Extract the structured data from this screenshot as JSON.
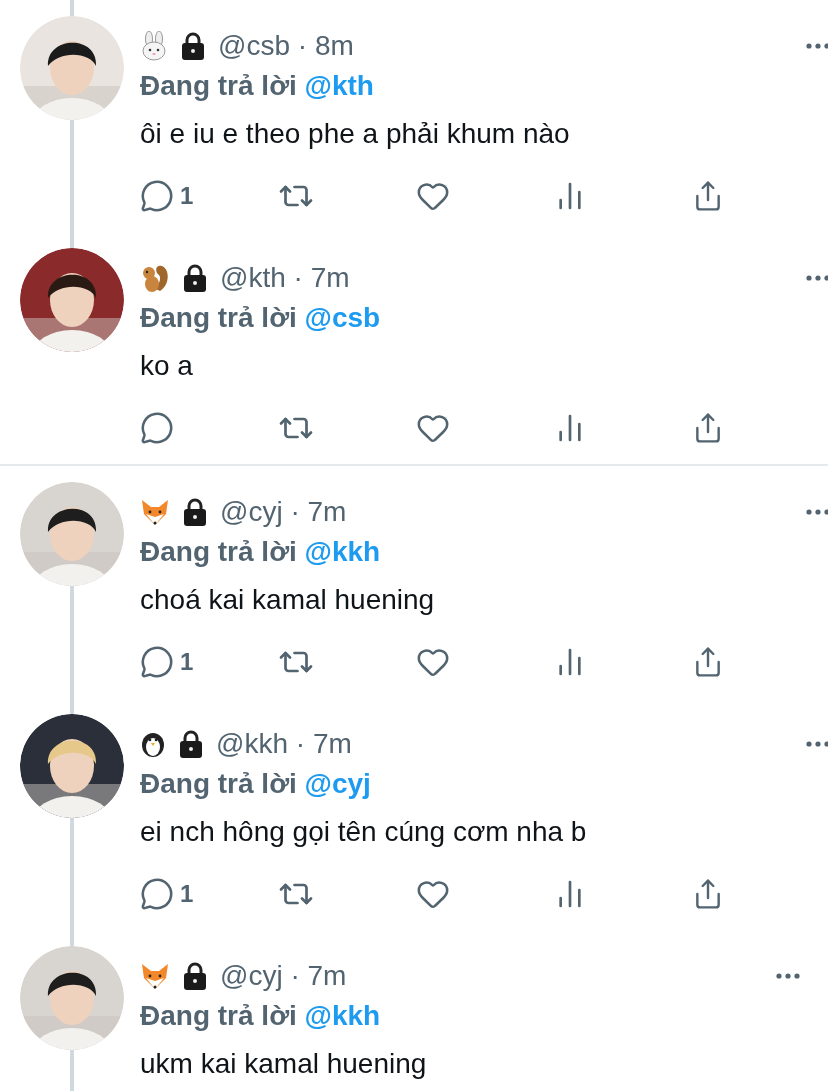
{
  "threads": [
    {
      "continues_above": true,
      "continues_below": false,
      "tweets": [
        {
          "badge": {
            "kind": "rabbit"
          },
          "meta": "@csb · 8m",
          "reply_label": "Đang trả lời",
          "reply_to": "@kth",
          "text": "ôi e iu e theo phe a phải khum nào",
          "actions": {
            "kind": "row",
            "reply_count": "1"
          }
        },
        {
          "badge": {
            "kind": "squirrel"
          },
          "meta": "@kth · 7m",
          "reply_label": "Đang trả lời",
          "reply_to": "@csb",
          "text": "ko a",
          "actions": {
            "kind": "row"
          }
        }
      ]
    },
    {
      "continues_above": false,
      "continues_below": true,
      "tweets": [
        {
          "badge": {
            "kind": "fox"
          },
          "meta": "@cyj · 7m",
          "reply_label": "Đang trả lời",
          "reply_to": "@kkh",
          "text": "choá kai kamal huening",
          "actions": {
            "kind": "row",
            "reply_count": "1"
          }
        },
        {
          "badge": {
            "kind": "penguin"
          },
          "meta": "@kkh · 7m",
          "reply_label": "Đang trả lời",
          "reply_to": "@cyj",
          "text": "ei nch hông gọi tên cúng cơm nha b",
          "actions": {
            "kind": "row",
            "reply_count": "1"
          }
        },
        {
          "badge": {
            "kind": "fox"
          },
          "meta": "@cyj · 7m",
          "reply_label": "Đang trả lời",
          "reply_to": "@kkh",
          "text": "ukm kai kamal huening"
        }
      ]
    }
  ]
}
